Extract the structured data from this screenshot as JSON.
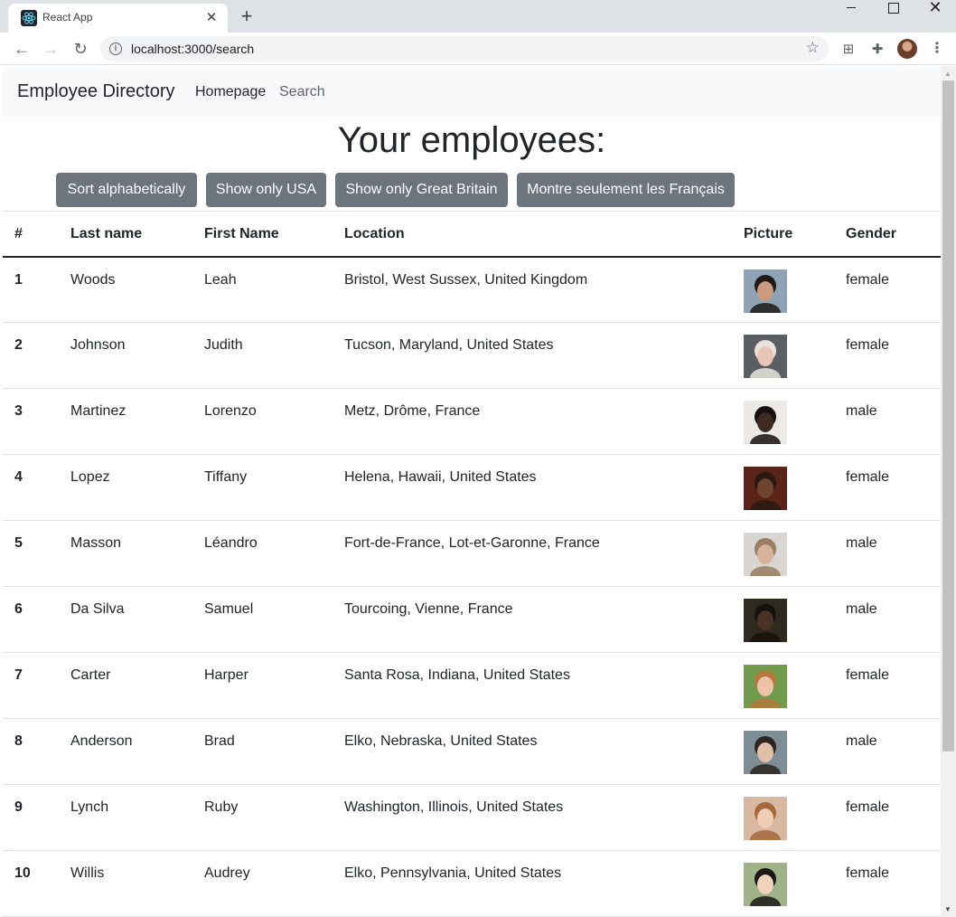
{
  "browser": {
    "tab_title": "React App",
    "url": "localhost:3000/search"
  },
  "app": {
    "brand": "Employee Directory",
    "nav": [
      "Homepage",
      "Search"
    ]
  },
  "page": {
    "title": "Your employees:",
    "buttons": [
      "Sort alphabetically",
      "Show only USA",
      "Show only Great Britain",
      "Montre seulement les Français"
    ]
  },
  "table": {
    "headers": [
      "#",
      "Last name",
      "First Name",
      "Location",
      "Picture",
      "Gender"
    ],
    "rows": [
      {
        "num": "1",
        "last": "Woods",
        "first": "Leah",
        "location": "Bristol, West Sussex, United Kingdom",
        "gender": "female",
        "photo": {
          "bg": "#8fa3b5",
          "skin": "#c99a7e",
          "hair": "#1e1a18"
        }
      },
      {
        "num": "2",
        "last": "Johnson",
        "first": "Judith",
        "location": "Tucson, Maryland, United States",
        "gender": "female",
        "photo": {
          "bg": "#5b5f63",
          "skin": "#e8c4b4",
          "hair": "#e9e3dc"
        }
      },
      {
        "num": "3",
        "last": "Martinez",
        "first": "Lorenzo",
        "location": "Metz, Drôme, France",
        "gender": "male",
        "photo": {
          "bg": "#eceae6",
          "skin": "#3d2a20",
          "hair": "#151110"
        }
      },
      {
        "num": "4",
        "last": "Lopez",
        "first": "Tiffany",
        "location": "Helena, Hawaii, United States",
        "gender": "female",
        "photo": {
          "bg": "#5a2418",
          "skin": "#6f4530",
          "hair": "#2a1a12"
        }
      },
      {
        "num": "5",
        "last": "Masson",
        "first": "Léandro",
        "location": "Fort-de-France, Lot-et-Garonne, France",
        "gender": "male",
        "photo": {
          "bg": "#d7d6d2",
          "skin": "#d7b39a",
          "hair": "#9a7d62"
        }
      },
      {
        "num": "6",
        "last": "Da Silva",
        "first": "Samuel",
        "location": "Tourcoing, Vienne, France",
        "gender": "male",
        "photo": {
          "bg": "#2f2a1f",
          "skin": "#4a3326",
          "hair": "#17110d"
        }
      },
      {
        "num": "7",
        "last": "Carter",
        "first": "Harper",
        "location": "Santa Rosa, Indiana, United States",
        "gender": "female",
        "photo": {
          "bg": "#6f9b4a",
          "skin": "#ecc3a8",
          "hair": "#b3793c"
        }
      },
      {
        "num": "8",
        "last": "Anderson",
        "first": "Brad",
        "location": "Elko, Nebraska, United States",
        "gender": "male",
        "photo": {
          "bg": "#7d8e97",
          "skin": "#e1c0aa",
          "hair": "#2c2520"
        }
      },
      {
        "num": "9",
        "last": "Lynch",
        "first": "Ruby",
        "location": "Washington, Illinois, United States",
        "gender": "female",
        "photo": {
          "bg": "#d8b8a0",
          "skin": "#f0cdb5",
          "hair": "#a4693d"
        }
      },
      {
        "num": "10",
        "last": "Willis",
        "first": "Audrey",
        "location": "Elko, Pennsylvania, United States",
        "gender": "female",
        "photo": {
          "bg": "#9fb28a",
          "skin": "#f0d2bd",
          "hair": "#1b1714"
        }
      }
    ]
  },
  "colors": {
    "button_bg": "#6c757d",
    "navbar_bg": "#f8f9fa",
    "text": "#212529",
    "react_logo": "#61dafb"
  }
}
